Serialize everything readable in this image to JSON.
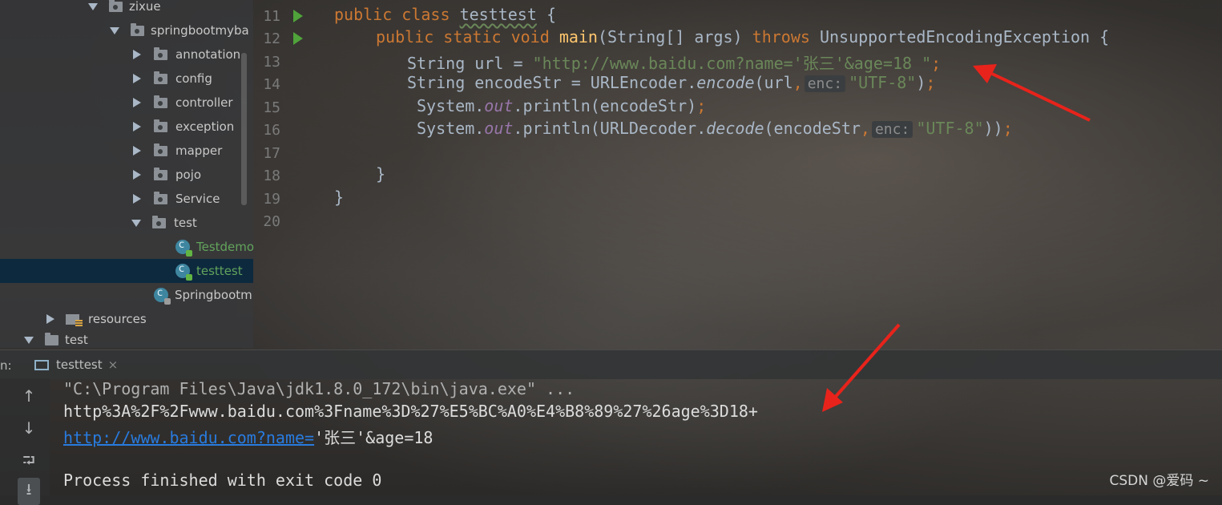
{
  "project_tree": {
    "items": [
      {
        "label": "zixue",
        "type": "package",
        "expanded": true
      },
      {
        "label": "springbootmyba",
        "type": "package",
        "expanded": true
      },
      {
        "label": "annotation",
        "type": "package",
        "expanded": false
      },
      {
        "label": "config",
        "type": "package",
        "expanded": false
      },
      {
        "label": "controller",
        "type": "package",
        "expanded": false
      },
      {
        "label": "exception",
        "type": "package",
        "expanded": false
      },
      {
        "label": "mapper",
        "type": "package",
        "expanded": false
      },
      {
        "label": "pojo",
        "type": "package",
        "expanded": false
      },
      {
        "label": "Service",
        "type": "package",
        "expanded": false
      },
      {
        "label": "test",
        "type": "package",
        "expanded": true
      },
      {
        "label": "Testdemo",
        "type": "class"
      },
      {
        "label": "testtest",
        "type": "class",
        "selected": true
      },
      {
        "label": "Springbootm",
        "type": "class"
      },
      {
        "label": "resources",
        "type": "resources",
        "expanded": false
      },
      {
        "label": "test",
        "type": "folder",
        "expanded": true
      }
    ]
  },
  "editor": {
    "line_numbers": [
      "11",
      "12",
      "13",
      "14",
      "15",
      "16",
      "17",
      "18",
      "19",
      "20"
    ],
    "lines": {
      "l11": {
        "kw1": "public",
        "kw2": "class",
        "name": "testtest",
        "brace": "{"
      },
      "l12": {
        "kw1": "public",
        "kw2": "static",
        "kw3": "void",
        "fn": "main",
        "params": "(String[] args)",
        "kw4": "throws",
        "exc": "UnsupportedEncodingException {"
      },
      "l13": {
        "decl": "String url = ",
        "str": "\"http://www.baidu.com?name='张三'&age=18 \"",
        "end": ";"
      },
      "l14": {
        "decl": "String encodeStr = URLEncoder.",
        "method": "encode",
        "args": "(url",
        "comma": ",",
        "hint": "enc:",
        "str": "\"UTF-8\"",
        "close": ")",
        "end": ";"
      },
      "l15": {
        "pre": "System.",
        "field": "out",
        "post": ".println(encodeStr)",
        "end": ";"
      },
      "l16": {
        "pre": "System.",
        "field": "out",
        "mid": ".println(URLDecoder.",
        "method": "decode",
        "args": "(encodeStr",
        "comma": ",",
        "hint": "enc:",
        "str": "\"UTF-8\"",
        "close": "))",
        "end": ";"
      },
      "l18": {
        "brace": "}"
      },
      "l19": {
        "brace": "}"
      }
    }
  },
  "run_panel": {
    "label": "n:",
    "tab_label": "testtest",
    "tab_close": "×",
    "buttons": {
      "up": "↑",
      "down": "↓",
      "wrap": "⮒",
      "scroll_end": "⭳"
    },
    "output": [
      "\"C:\\Program Files\\Java\\jdk1.8.0_172\\bin\\java.exe\" ...",
      "http%3A%2F%2Fwww.baidu.com%3Fname%3D%27%E5%BC%A0%E4%B8%89%27%26age%3D18+",
      {
        "link": "http://www.baidu.com?name=",
        "rest": "'张三'&age=18"
      },
      "",
      "Process finished with exit code 0"
    ]
  },
  "watermark": "CSDN @爱码 ~",
  "colors": {
    "keyword": "#cc7832",
    "function": "#ffc66d",
    "string": "#6a8759",
    "field": "#9876aa",
    "link": "#287bde",
    "annotation_arrow": "#e8231b"
  }
}
